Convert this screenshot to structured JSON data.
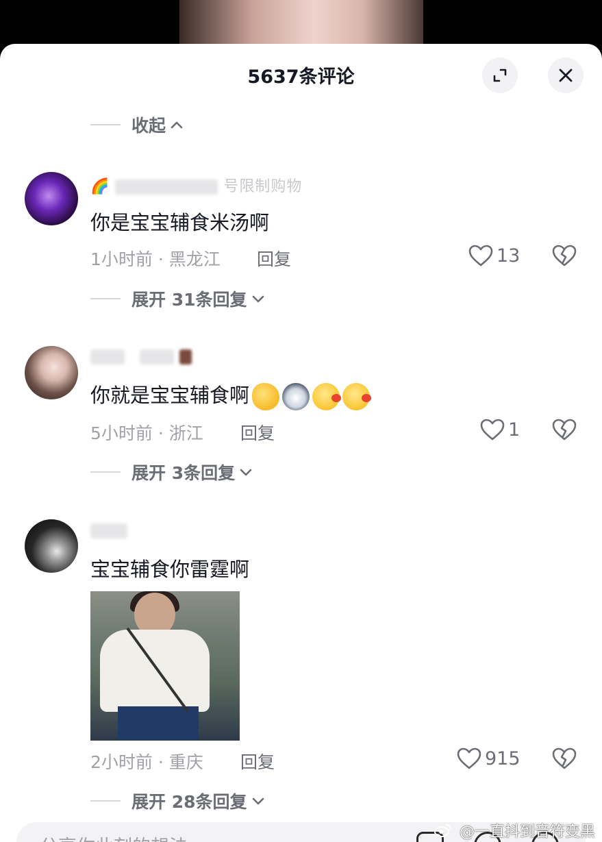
{
  "header": {
    "title": "5637条评论"
  },
  "collapse_label": "收起",
  "comments": [
    {
      "username": "🌈",
      "username_tail": "号限制购物",
      "text": "你是宝宝辅食米汤啊",
      "time_location": "1小时前 · 黑龙江",
      "reply_label": "回复",
      "likes": "13",
      "expand_label": "展开 31条回复"
    },
    {
      "username": "",
      "text": "你就是宝宝辅食啊",
      "time_location": "5小时前 · 浙江",
      "reply_label": "回复",
      "likes": "1",
      "expand_label": "展开 3条回复"
    },
    {
      "username": "",
      "text": "宝宝辅食你雷霆啊",
      "time_location": "2小时前 · 重庆",
      "reply_label": "回复",
      "likes": "915",
      "expand_label": "展开 28条回复"
    }
  ],
  "input": {
    "placeholder": "分享你此刻的想法"
  },
  "watermark": "@一直抖到音符变黑",
  "colors": {
    "primary_text": "#161823",
    "secondary_text": "#a0a1a7",
    "muted_text": "#6b6d75",
    "sheet_bg": "#ffffff"
  },
  "icons": [
    "expand-icon",
    "close-icon",
    "chevron-up-icon",
    "chevron-down-icon",
    "heart-icon",
    "broken-heart-icon",
    "weibo-logo"
  ]
}
